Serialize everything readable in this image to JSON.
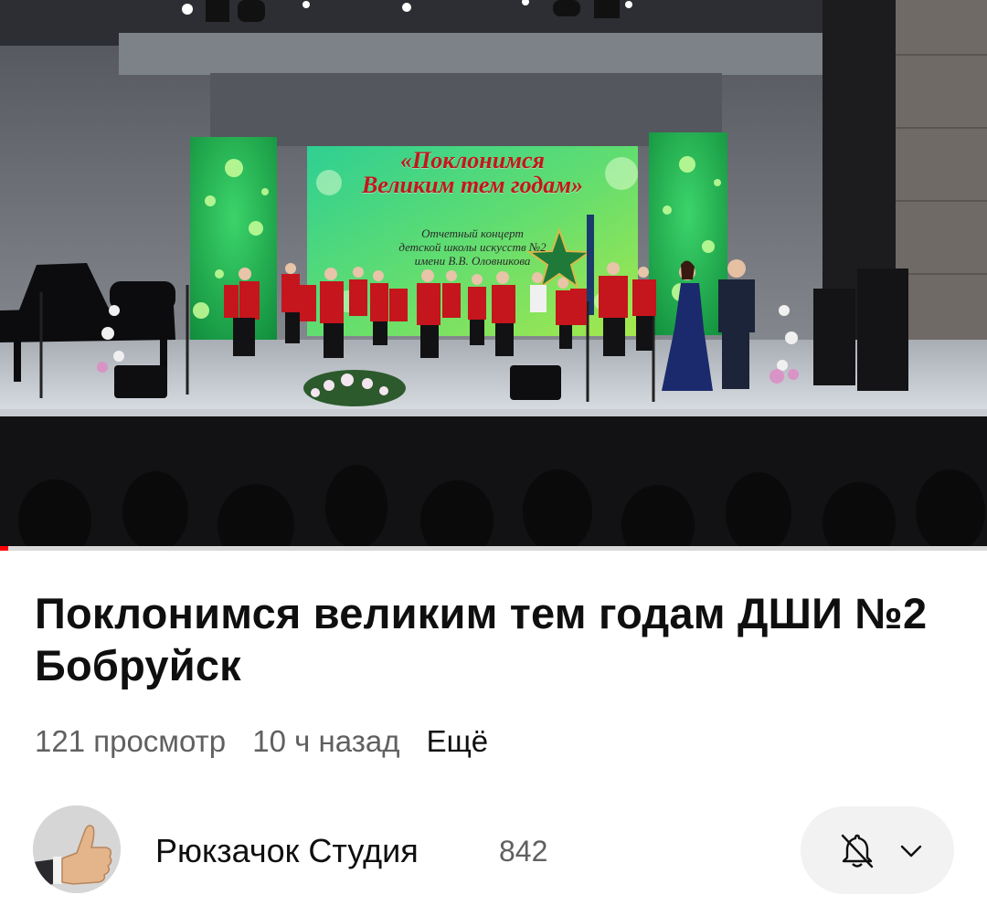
{
  "video": {
    "screen_text": {
      "title_line1": "«Поклонимся",
      "title_line2": "Великим тем годам»",
      "sub_line1": "Отчетный концерт",
      "sub_line2": "детской школы искусств №2",
      "sub_line3": "имени В.В. Оловникова"
    },
    "progress_fraction": 0.008
  },
  "details": {
    "title": "Поклонимся великим тем годам ДШИ №2 Бобруйск",
    "views": "121 просмотр",
    "time_ago": "10 ч назад",
    "more_label": "Ещё"
  },
  "channel": {
    "name": "Рюкзачок Студия",
    "subscribers": "842",
    "avatar_icon": "thumbs-up-icon",
    "notification_icon": "bell-off-icon",
    "dropdown_icon": "chevron-down-icon"
  },
  "colors": {
    "progress": "#ff0000",
    "jacket": "#c4161c",
    "stage_screen": "#3fd47e"
  }
}
